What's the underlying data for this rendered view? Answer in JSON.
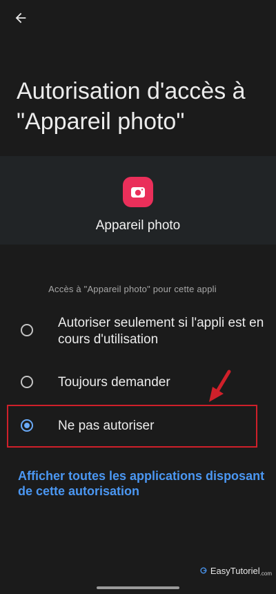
{
  "title": "Autorisation d'accès à \"Appareil photo\"",
  "app": {
    "name": "Appareil photo",
    "icon": "camera-icon",
    "icon_color": "#ea2f5a"
  },
  "section_label": "Accès à \"Appareil photo\" pour cette appli",
  "options": [
    {
      "label": "Autoriser seulement si l'appli est en cours d'utilisation",
      "selected": false
    },
    {
      "label": "Toujours demander",
      "selected": false
    },
    {
      "label": "Ne pas autoriser",
      "selected": true
    }
  ],
  "link_text": "Afficher toutes les applications disposant de cette autorisation",
  "watermark": {
    "text": "EasyTutoriel",
    "suffix": ".com"
  },
  "colors": {
    "accent": "#6aaaf7",
    "link": "#4b97f2",
    "highlight": "#d0202a",
    "background": "#1b1b1b"
  }
}
